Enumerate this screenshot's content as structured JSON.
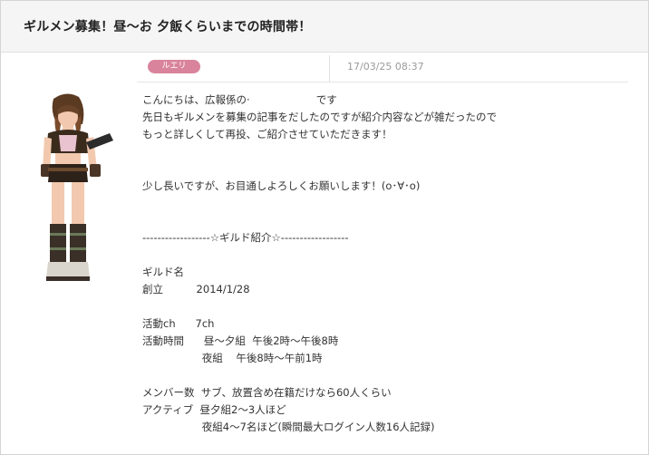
{
  "post": {
    "title": "ギルメン募集！昼〜お 夕飯くらいまでの時間帯！",
    "author_tag": "ルエリ",
    "timestamp": "17/03/25 08:37"
  },
  "body_lines": [
    "こんにちは、広報係の·                    です",
    "先日もギルメンを募集の記事をだしたのですが紹介内容などが雑だったので",
    "もっと詳しくして再投、ご紹介させていただきます！",
    "",
    "",
    "少し長いですが、お目通しよろしくお願いします！(o･∀･o)",
    "",
    "",
    "------------------☆ギルド紹介☆------------------",
    "",
    "ギルド名",
    "創立          2014/1/28",
    "",
    "活動ch      7ch",
    "活動時間      昼〜夕組  午後2時〜午後8時",
    "                  夜組    午後8時〜午前1時",
    "",
    "メンバー数  サブ、放置含め在籍だけなら60人くらい",
    "アクティブ  昼夕組2〜3人ほど",
    "                  夜組4〜7名ほど(瞬間最大ログイン人数16人記録)"
  ]
}
